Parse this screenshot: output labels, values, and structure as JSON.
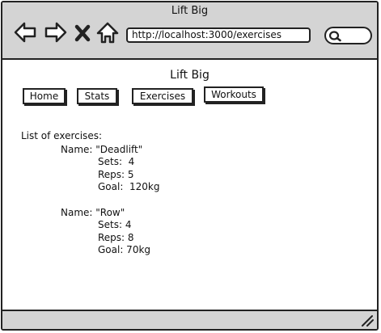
{
  "window": {
    "title": "Lift Big"
  },
  "toolbar": {
    "icons": [
      "back-arrow-icon",
      "forward-arrow-icon",
      "close-x-icon",
      "home-icon"
    ],
    "url": "http://localhost:3000/exercises",
    "search_icon": "search-icon"
  },
  "page": {
    "title": "Lift Big",
    "nav": [
      {
        "label": "Home"
      },
      {
        "label": "Stats"
      },
      {
        "label": "Exercises"
      },
      {
        "label": "Workouts"
      }
    ],
    "list_heading": "List of exercises:",
    "exercises": [
      {
        "name": "Name: \"Deadlift\"",
        "sets": "Sets:  4",
        "reps": "Reps: 5",
        "goal": "Goal:  120kg"
      },
      {
        "name": "Name: \"Row\"",
        "sets": "Sets: 4",
        "reps": "Reps: 8",
        "goal": "Goal: 70kg"
      }
    ]
  },
  "colors": {
    "chrome": "#d4d4d4",
    "border": "#222222",
    "background": "#ffffff"
  }
}
